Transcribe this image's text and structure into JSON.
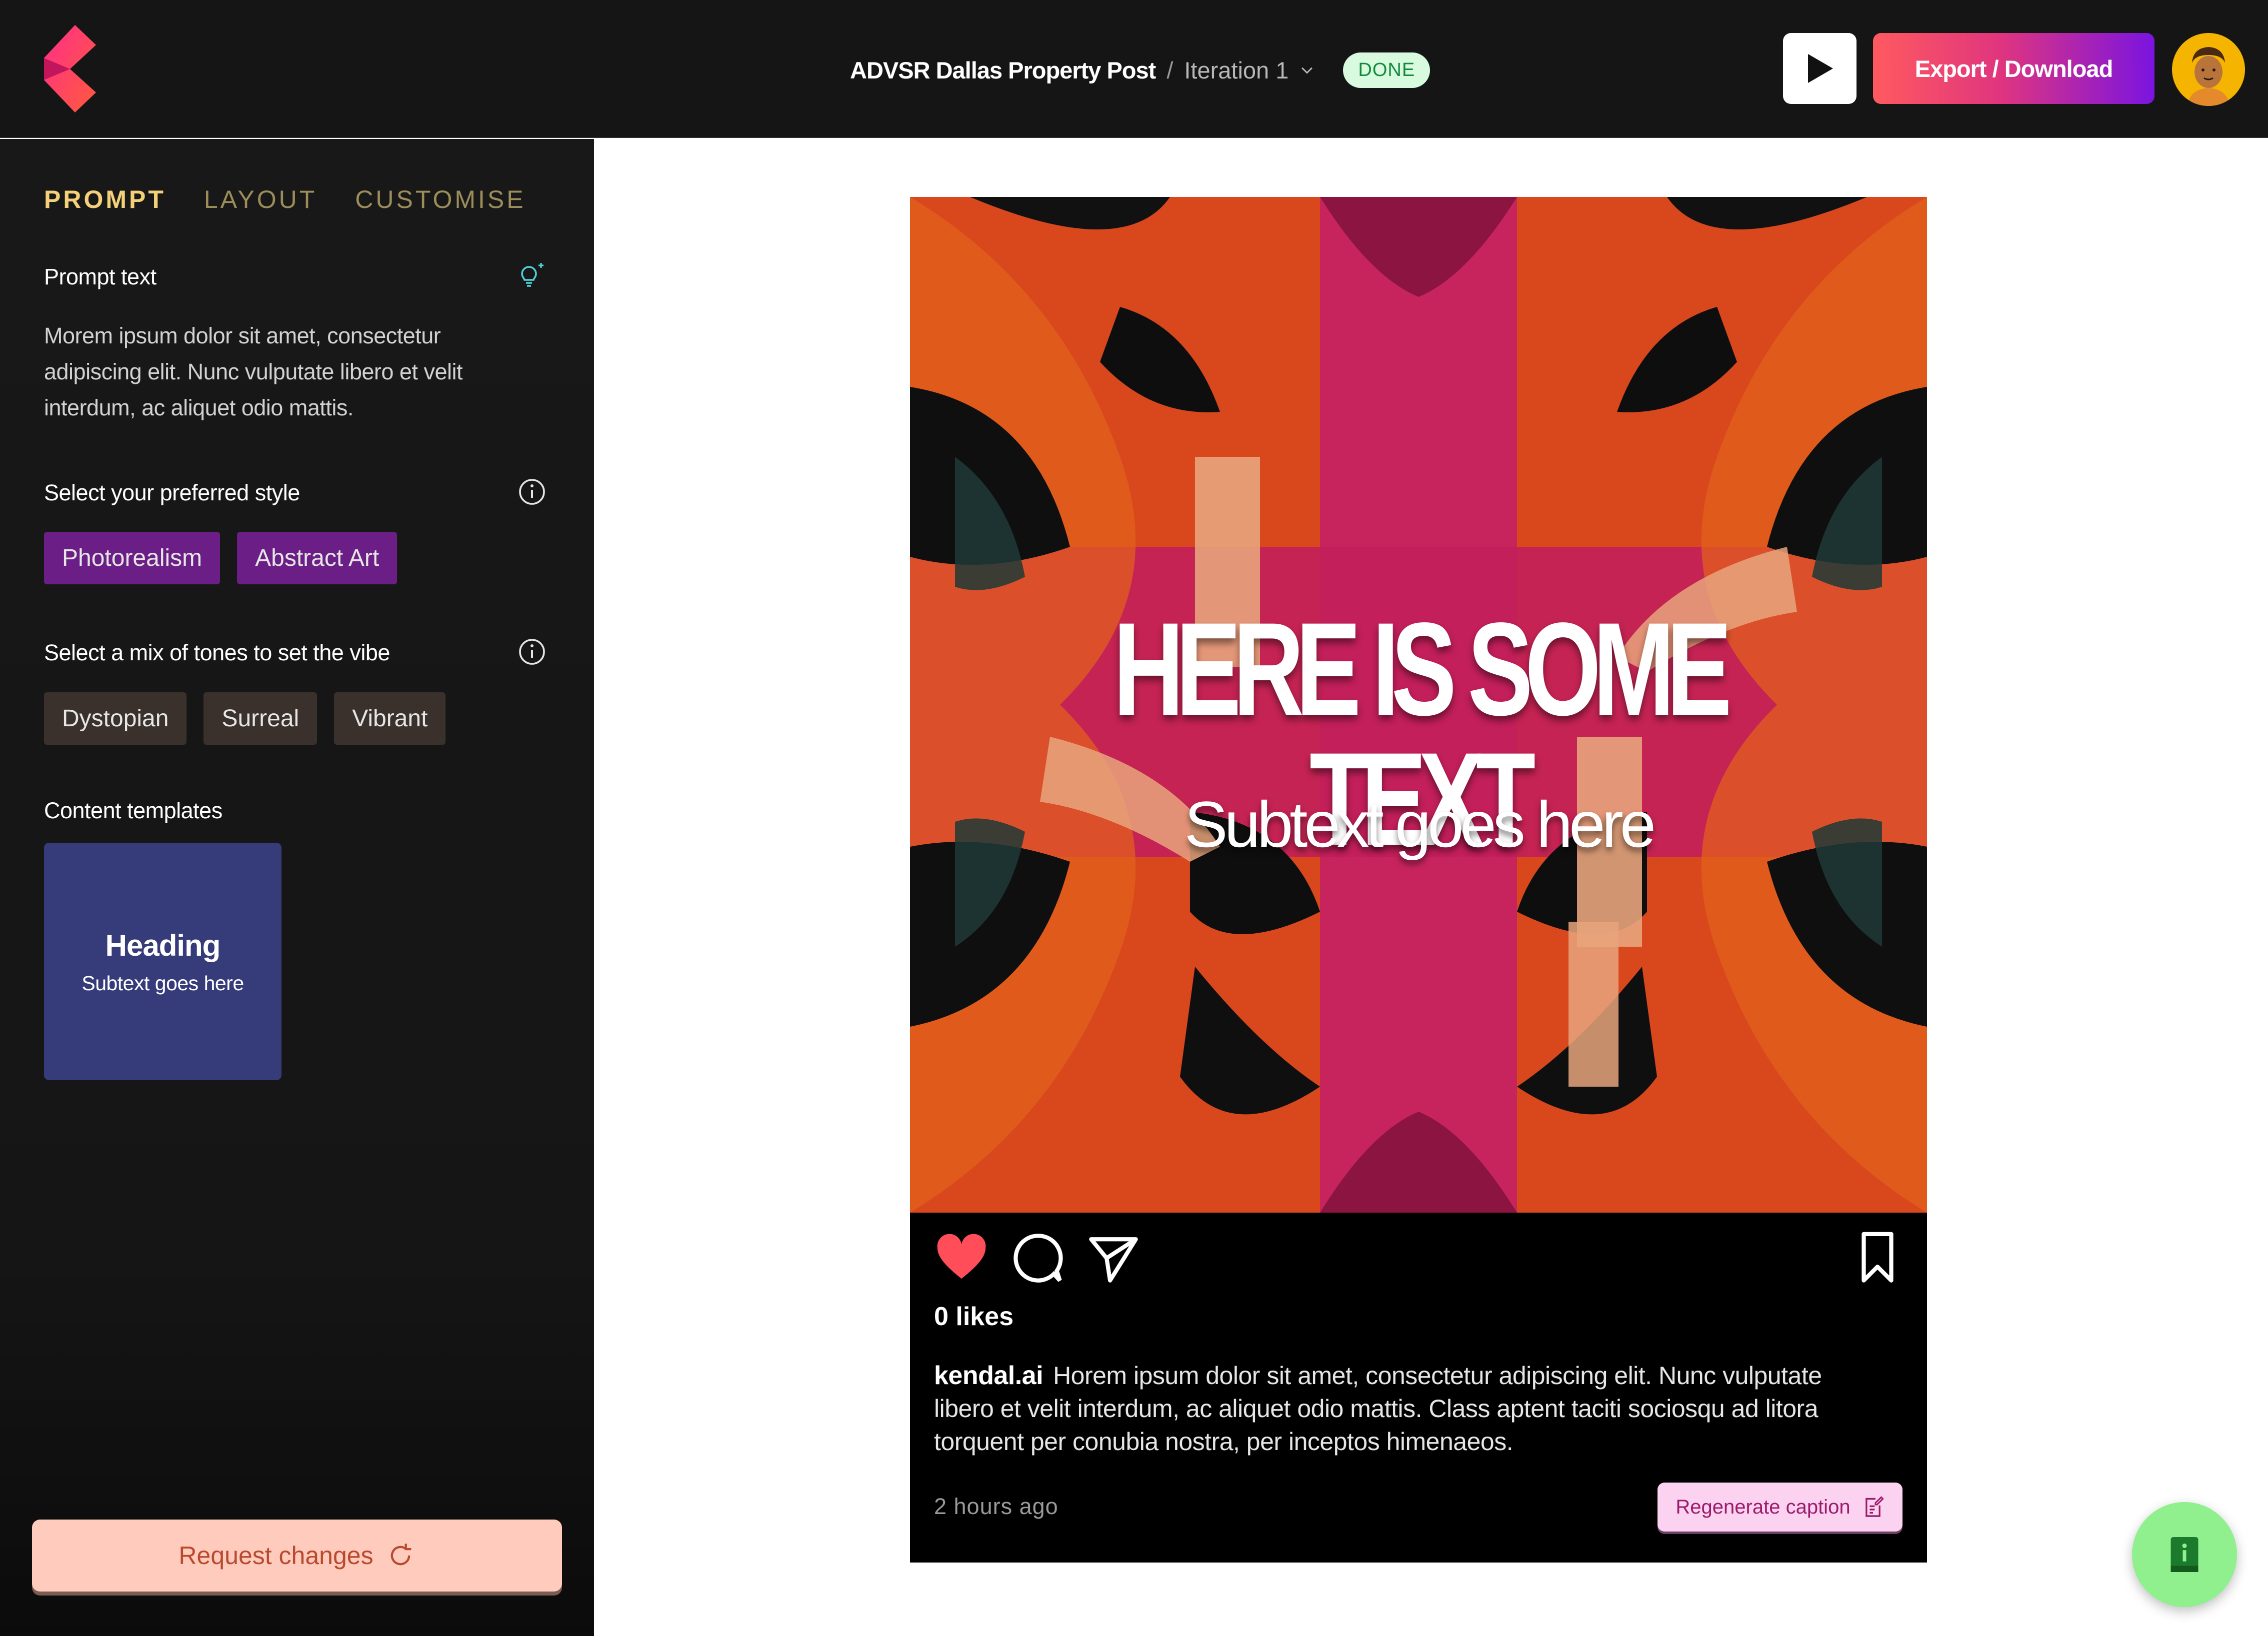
{
  "header": {
    "project_title": "ADVSR Dallas Property Post",
    "separator": "/",
    "iteration": "Iteration 1",
    "status_badge": "DONE",
    "export_label": "Export  / Download"
  },
  "sidebar": {
    "tabs": [
      {
        "label": "PROMPT",
        "active": true
      },
      {
        "label": "LAYOUT",
        "active": false
      },
      {
        "label": "CUSTOMISE",
        "active": false
      }
    ],
    "prompt_label": "Prompt text",
    "prompt_text": "Morem ipsum dolor sit amet, consectetur adipiscing elit. Nunc vulputate libero et velit interdum, ac aliquet odio mattis.",
    "style_label": "Select your preferred style",
    "styles": [
      "Photorealism",
      "Abstract Art"
    ],
    "tone_label": "Select a mix of tones to set the vibe",
    "tones": [
      "Dystopian",
      "Surreal",
      "Vibrant"
    ],
    "templates_label": "Content templates",
    "template": {
      "heading": "Heading",
      "subtext": "Subtext goes here"
    },
    "request_changes_label": "Request changes"
  },
  "post": {
    "overlay_title": "HERE IS SOME TEXT",
    "overlay_subtext": "Subtext goes here",
    "likes": "0 likes",
    "username": "kendal.ai",
    "caption": "Horem ipsum dolor sit amet, consectetur adipiscing elit. Nunc vulputate libero et velit interdum, ac aliquet odio mattis. Class aptent taciti sociosqu ad litora torquent per conubia nostra, per inceptos himenaeos.",
    "time_ago": "2 hours ago",
    "regenerate_label": "Regenerate caption"
  },
  "colors": {
    "accent_gold": "#f4d179",
    "chip_purple": "#6b1e85",
    "chip_brown": "#3a312c",
    "done_green": "#138a3b",
    "like_red": "#ff4d5a",
    "fab_green": "#8ff08d"
  },
  "icons": [
    "kendal-logo-icon",
    "chevron-down-icon",
    "play-icon",
    "avatar-icon",
    "lightbulb-sparkle-icon",
    "info-icon",
    "refresh-icon",
    "heart-icon",
    "comment-icon",
    "send-icon",
    "bookmark-icon",
    "edit-document-icon",
    "info-book-icon"
  ]
}
